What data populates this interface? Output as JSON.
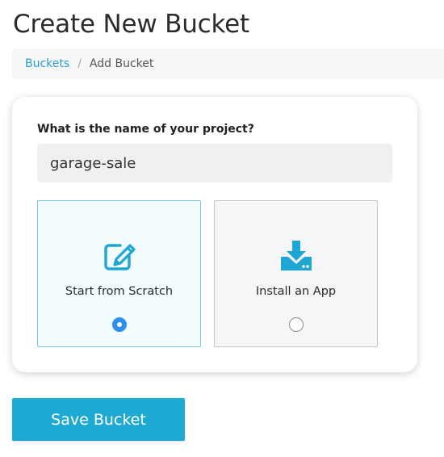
{
  "page": {
    "title": "Create New Bucket"
  },
  "breadcrumb": {
    "parent": "Buckets",
    "separator": "/",
    "current": "Add Bucket"
  },
  "form": {
    "name_label": "What is the name of your project?",
    "name_value": "garage-sale"
  },
  "options": [
    {
      "label": "Start from Scratch",
      "icon": "edit-icon",
      "selected": true
    },
    {
      "label": "Install an App",
      "icon": "download-icon",
      "selected": false
    }
  ],
  "actions": {
    "save_label": "Save Bucket"
  },
  "colors": {
    "accent": "#1eaad3",
    "link": "#2a9fcf",
    "radio_selected": "#2f8ff0",
    "selected_border": "#7cc7e2",
    "selected_background": "#f3fcfe"
  }
}
